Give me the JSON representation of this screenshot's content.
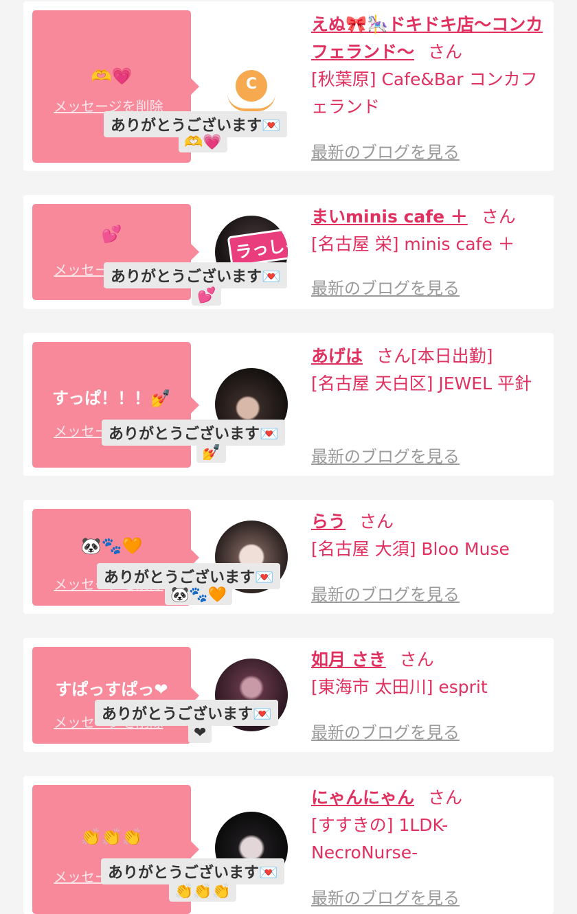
{
  "common": {
    "delete_label": "メッセージを削除",
    "thanks_label": "ありがとうございます💌",
    "san_label": "さん",
    "blog_label": "最新のブログを見る"
  },
  "cards": [
    {
      "message": "🫶💗",
      "name": "えぬ🎀🎠ドキドキ店〜コンカフェランド〜",
      "status": "",
      "shop": "[秋葉原] Cafe&Bar コンカフェランド",
      "reply_emoji": "🫶💗",
      "avatar": "cafe-land-logo"
    },
    {
      "message": "💕",
      "name": "まいminis cafe ＋",
      "status": "",
      "shop": "[名古屋 栄] minis cafe ＋",
      "reply_emoji": "💕",
      "avatar": "girl-photo"
    },
    {
      "message": "すっぱ！！！💅",
      "name": "あげは",
      "status": "[本日出勤]",
      "shop": "[名古屋 天白区] JEWEL 平針",
      "reply_emoji": "💅",
      "avatar": "girl-photo"
    },
    {
      "message": "🐼🐾🧡",
      "name": "らう",
      "status": "",
      "shop": "[名古屋 大須] Bloo Muse",
      "reply_emoji": "🐼🐾🧡",
      "avatar": "girl-photo"
    },
    {
      "message": "すぱっすぱっ❤",
      "name": "如月 さき",
      "status": "",
      "shop": "[東海市 太田川] esprit",
      "reply_emoji": "❤",
      "avatar": "girl-photo"
    },
    {
      "message": "👏👏👏",
      "name": "にゃんにゃん",
      "status": "",
      "shop": "[すすきの] 1LDK-NecroNurse-",
      "reply_emoji": "👏👏👏",
      "avatar": "girl-photo"
    }
  ],
  "avatar_stamp": "ラっしゃい!",
  "logo_letter": "C",
  "colors": {
    "accent": "#e0305f",
    "bubble": "#f8899b",
    "link_gray": "#9a9a9a"
  }
}
